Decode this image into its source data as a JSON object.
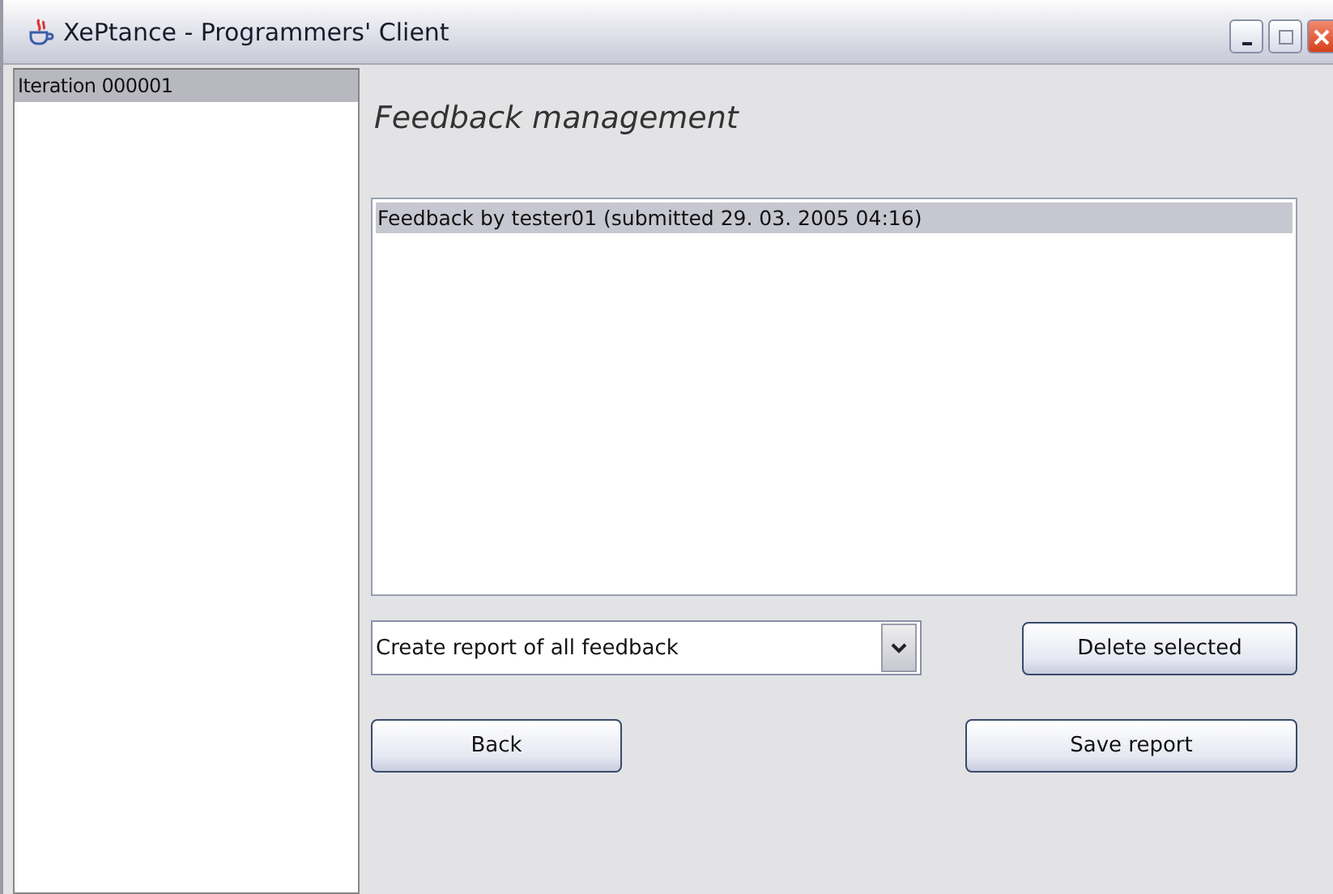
{
  "window": {
    "title": "XePtance - Programmers' Client"
  },
  "sidebar": {
    "items": [
      {
        "label": "Iteration 000001",
        "selected": true
      }
    ]
  },
  "heading": "Feedback management",
  "feedback_list": {
    "items": [
      {
        "label": "Feedback by tester01 (submitted 29. 03. 2005 04:16)",
        "selected": true
      }
    ]
  },
  "report_dropdown": {
    "value": "Create report of all feedback"
  },
  "buttons": {
    "delete": "Delete selected",
    "back": "Back",
    "save": "Save report"
  }
}
